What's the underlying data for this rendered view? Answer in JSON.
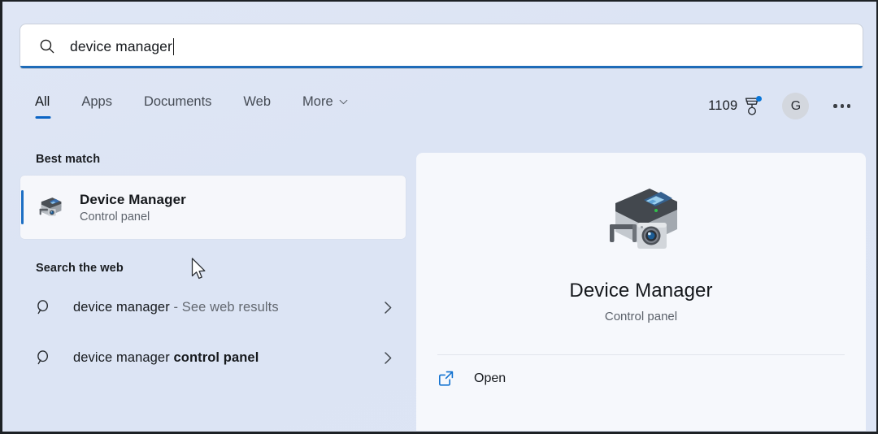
{
  "search": {
    "value": "device manager",
    "icon": "search-icon",
    "caret_visible": true
  },
  "tabs": [
    {
      "label": "All",
      "active": true
    },
    {
      "label": "Apps",
      "active": false
    },
    {
      "label": "Documents",
      "active": false
    },
    {
      "label": "Web",
      "active": false
    },
    {
      "label": "More",
      "active": false,
      "icon": "chevron-down-icon"
    }
  ],
  "header_right": {
    "rewards_count": "1109",
    "rewards_icon": "rewards-medal-icon",
    "rewards_badge": true,
    "avatar_initial": "G",
    "overflow_icon": "ellipsis-icon"
  },
  "results": {
    "best_match_heading": "Best match",
    "best_match": {
      "title": "Device Manager",
      "subtitle": "Control panel",
      "icon": "device-manager-icon",
      "selected": true
    },
    "web_heading": "Search the web",
    "web_items": [
      {
        "query": "device manager",
        "suffix": " - See web results",
        "suffix_style": "muted",
        "icon": "magnifier-icon",
        "chevron": "chevron-right-icon"
      },
      {
        "query": "device manager ",
        "suffix": "control panel",
        "suffix_style": "strong",
        "icon": "magnifier-icon",
        "chevron": "chevron-right-icon"
      }
    ]
  },
  "preview": {
    "icon": "device-manager-icon-large",
    "title": "Device Manager",
    "subtitle": "Control panel",
    "actions": [
      {
        "label": "Open",
        "icon": "open-external-icon"
      }
    ]
  },
  "colors": {
    "background": "#dce4f4",
    "accent_blue": "#0b64c4",
    "focus_underline": "#1e6bb8",
    "panel": "#f6f8fc",
    "selected_row": "#f6f7fb",
    "link_blue": "#1272d0",
    "badge_blue": "#0a76d8"
  }
}
